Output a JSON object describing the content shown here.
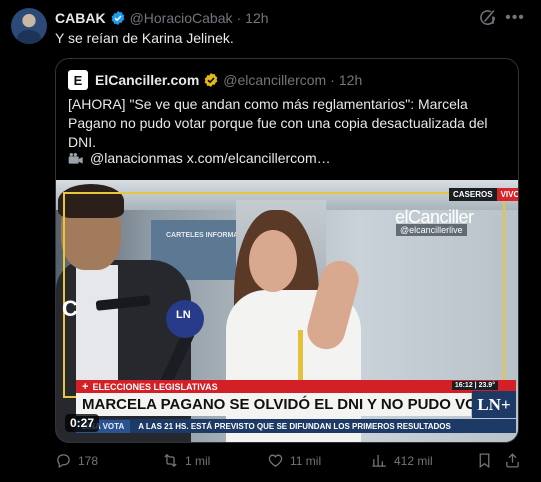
{
  "tweet": {
    "author_name": "CABAK",
    "author_handle": "@HoracioCabak",
    "separator": "·",
    "time": "12h",
    "text": "Y se reían de Karina Jelinek."
  },
  "quote": {
    "logo_letter": "E",
    "author_name": "ElCanciller.com",
    "author_handle": "@elcancillercom",
    "separator": "·",
    "time": "12h",
    "text": "[AHORA] \"Se ve que andan como más reglamentarios\": Marcela Pagano no pudo votar porque fue con una copia desactualizada del DNI.",
    "link_text": "@lanacionmas  x.com/elcancillercom…"
  },
  "video": {
    "duration": "0:27",
    "location_tag": "CASEROS",
    "live_tag": "VIVO",
    "brand": "elCanciller",
    "brand_handle": "@elcancillerlive",
    "c_logo": "C",
    "mic_label": "LN",
    "board_text": "CARTELES INFORMATIVOS",
    "banner_top": "ELECCIONES LEGISLATIVAS",
    "banner_top_symbol": "+",
    "clock": "16:12 | 23.9°",
    "headline": "MARCELA PAGANO SE OLVIDÓ EL DNI Y NO PUDO VOTAR",
    "channel_logo": "LN+",
    "ticker_a": "LINA VOTA",
    "ticker_b": "A LAS 21 HS. ESTÁ PREVISTO QUE SE DIFUNDAN LOS PRIMEROS RESULTADOS"
  },
  "actions": {
    "replies": "178",
    "reposts": "1 mil",
    "likes": "11 mil",
    "views": "412 mil"
  },
  "colors": {
    "background": "#000000",
    "muted_text": "#71767b",
    "verified_blue": "#1d9bf0",
    "verified_gold": "#e2b719",
    "frame_yellow": "#e6c63a",
    "banner_red": "#d31f26"
  },
  "icons": [
    "grok-icon",
    "more-icon",
    "verified-icon",
    "gold-verified-icon",
    "camera-icon",
    "reply-icon",
    "repost-icon",
    "like-icon",
    "views-icon",
    "bookmark-icon",
    "share-icon"
  ]
}
